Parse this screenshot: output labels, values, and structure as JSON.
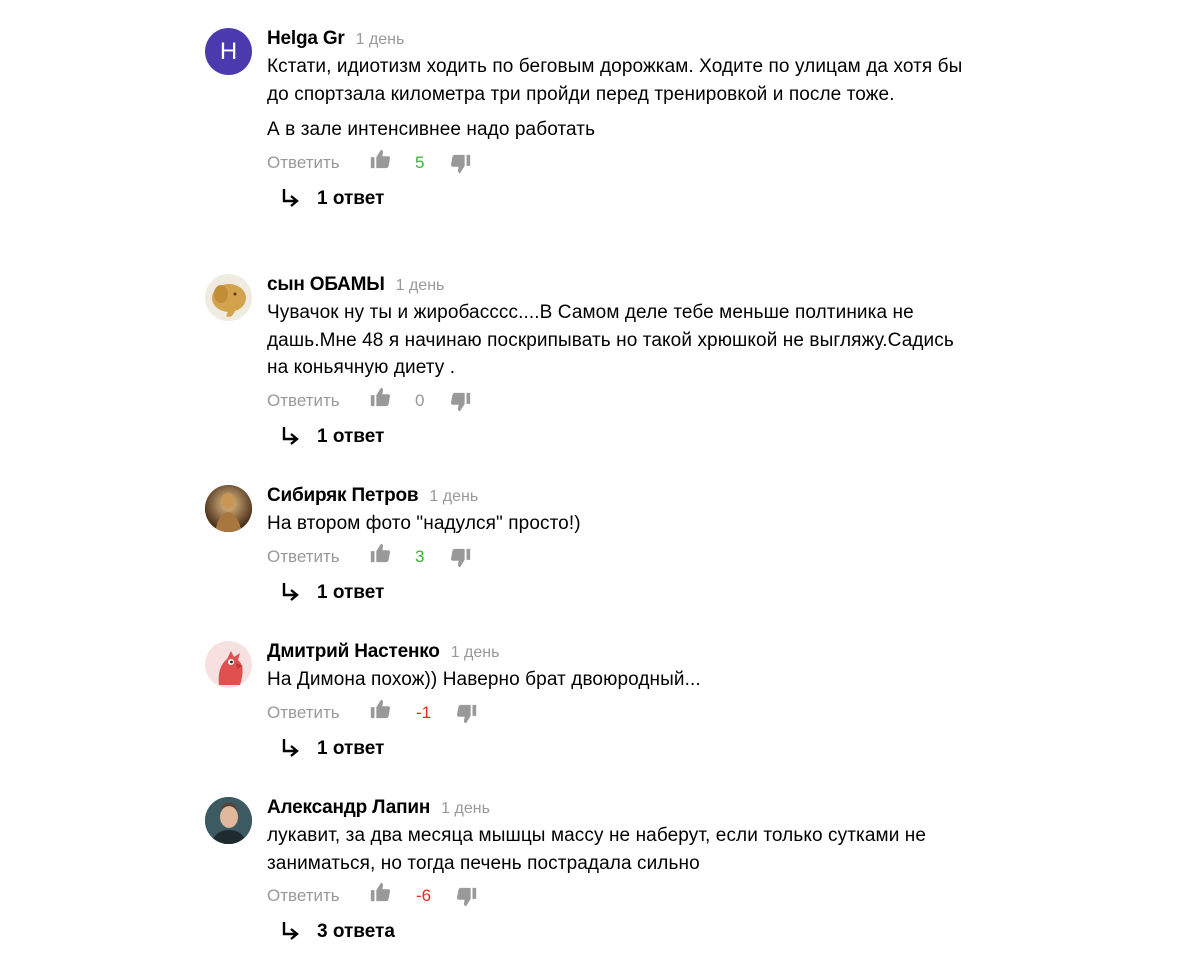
{
  "reply_label": "Ответить",
  "colors": {
    "positive": "#3cb037",
    "neutral": "#999999",
    "negative": "#e52b1c"
  },
  "comments": [
    {
      "author": "Helga Gr",
      "time": "1 день",
      "avatar_letter": "H",
      "paragraphs": [
        "Кстати, идиотизм ходить по беговым дорожкам. Ходите по улицам да хотя бы до спортзала километра три пройди перед тренировкой и после тоже.",
        "А в зале интенсивнее надо работать"
      ],
      "score": "5",
      "answers": "1 ответ"
    },
    {
      "author": "сын ОБАМЫ",
      "time": "1 день",
      "avatar_icon": "elephant-avatar-icon",
      "paragraphs": [
        "Чувачок ну ты и жиробасссс....В Самом деле тебе меньше полтиника не дашь.Мне 48 я начинаю поскрипывать но такой хрюшкой не выгляжу.Садись на коньячную диету ."
      ],
      "score": "0",
      "answers": "1 ответ"
    },
    {
      "author": "Сибиряк Петров",
      "time": "1 день",
      "avatar_icon": "statue-photo-avatar",
      "paragraphs": [
        "На втором фото \"надулся\" просто!)"
      ],
      "score": "3",
      "answers": "1 ответ"
    },
    {
      "author": "Дмитрий Настенко",
      "time": "1 день",
      "avatar_icon": "parrot-avatar-icon",
      "paragraphs": [
        "На Димона похож)) Наверно брат двоюродный..."
      ],
      "score": "-1",
      "answers": "1 ответ"
    },
    {
      "author": "Александр Лапин",
      "time": "1 день",
      "avatar_icon": "person-photo-avatar",
      "paragraphs": [
        "лукавит, за два месяца мышцы массу не наберут, если только сутками не заниматься, но тогда печень пострадала сильно"
      ],
      "score": "-6",
      "answers": "3 ответа"
    }
  ]
}
